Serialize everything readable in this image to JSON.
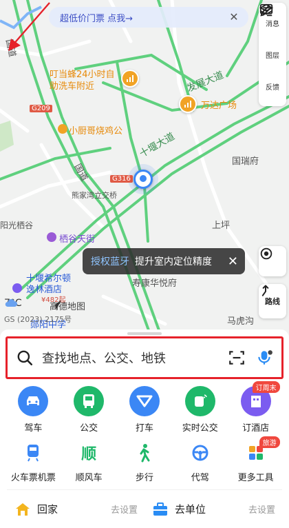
{
  "promo": {
    "text": "超低价门票 点我→"
  },
  "tools": {
    "messages": "消息",
    "layers": "图层",
    "feedback": "反馈"
  },
  "map": {
    "labels": {
      "road_g209": "G209",
      "road_g316": "G316",
      "national_road_1": "国道",
      "national_road_2": "国道",
      "carwash": "叮当蜂24小时自助洗车附近",
      "wanda": "万达广场",
      "chicken": "小厨哥烧鸡公",
      "fazhan_ave": "发展大道",
      "shiyan_ave": "十堰大道",
      "guoruifu": "国瑞府",
      "interchange": "熊家湾立交桥",
      "shangping": "上坪",
      "yangguang": "阳光栖谷",
      "qigu_street": "栖谷天街",
      "hilton_1": "十堰希尔顿",
      "hilton_2": "逸林酒店",
      "hilton_price": "¥482起",
      "shoukang": "寿康华悦府",
      "mahugou": "马虎沟",
      "middle_school": "郧阳中学"
    }
  },
  "bluetooth_toast": {
    "link": "授权蓝牙",
    "message": "提升室内定位精度"
  },
  "route_button": {
    "label": "路线"
  },
  "weather": {
    "temp": "7°C"
  },
  "logo": {
    "text": "高德地图"
  },
  "license": {
    "text": "GS (2023) 2175号"
  },
  "search": {
    "placeholder": "查找地点、公交、地铁"
  },
  "quick_actions": [
    {
      "label": "驾车",
      "color": "#3b87f5"
    },
    {
      "label": "公交",
      "color": "#1fb86a"
    },
    {
      "label": "打车",
      "color": "#3b87f5"
    },
    {
      "label": "实时公交",
      "color": "#1fb86a"
    },
    {
      "label": "订酒店",
      "color": "#7b5cf0",
      "badge": "订周末"
    }
  ],
  "services": [
    {
      "label": "火车票机票"
    },
    {
      "label": "顺风车"
    },
    {
      "label": "步行"
    },
    {
      "label": "代驾"
    },
    {
      "label": "更多工具",
      "badge": "旅游"
    }
  ],
  "home": {
    "name": "回家",
    "set": "去设置"
  },
  "work": {
    "name": "去单位",
    "set": "去设置"
  }
}
